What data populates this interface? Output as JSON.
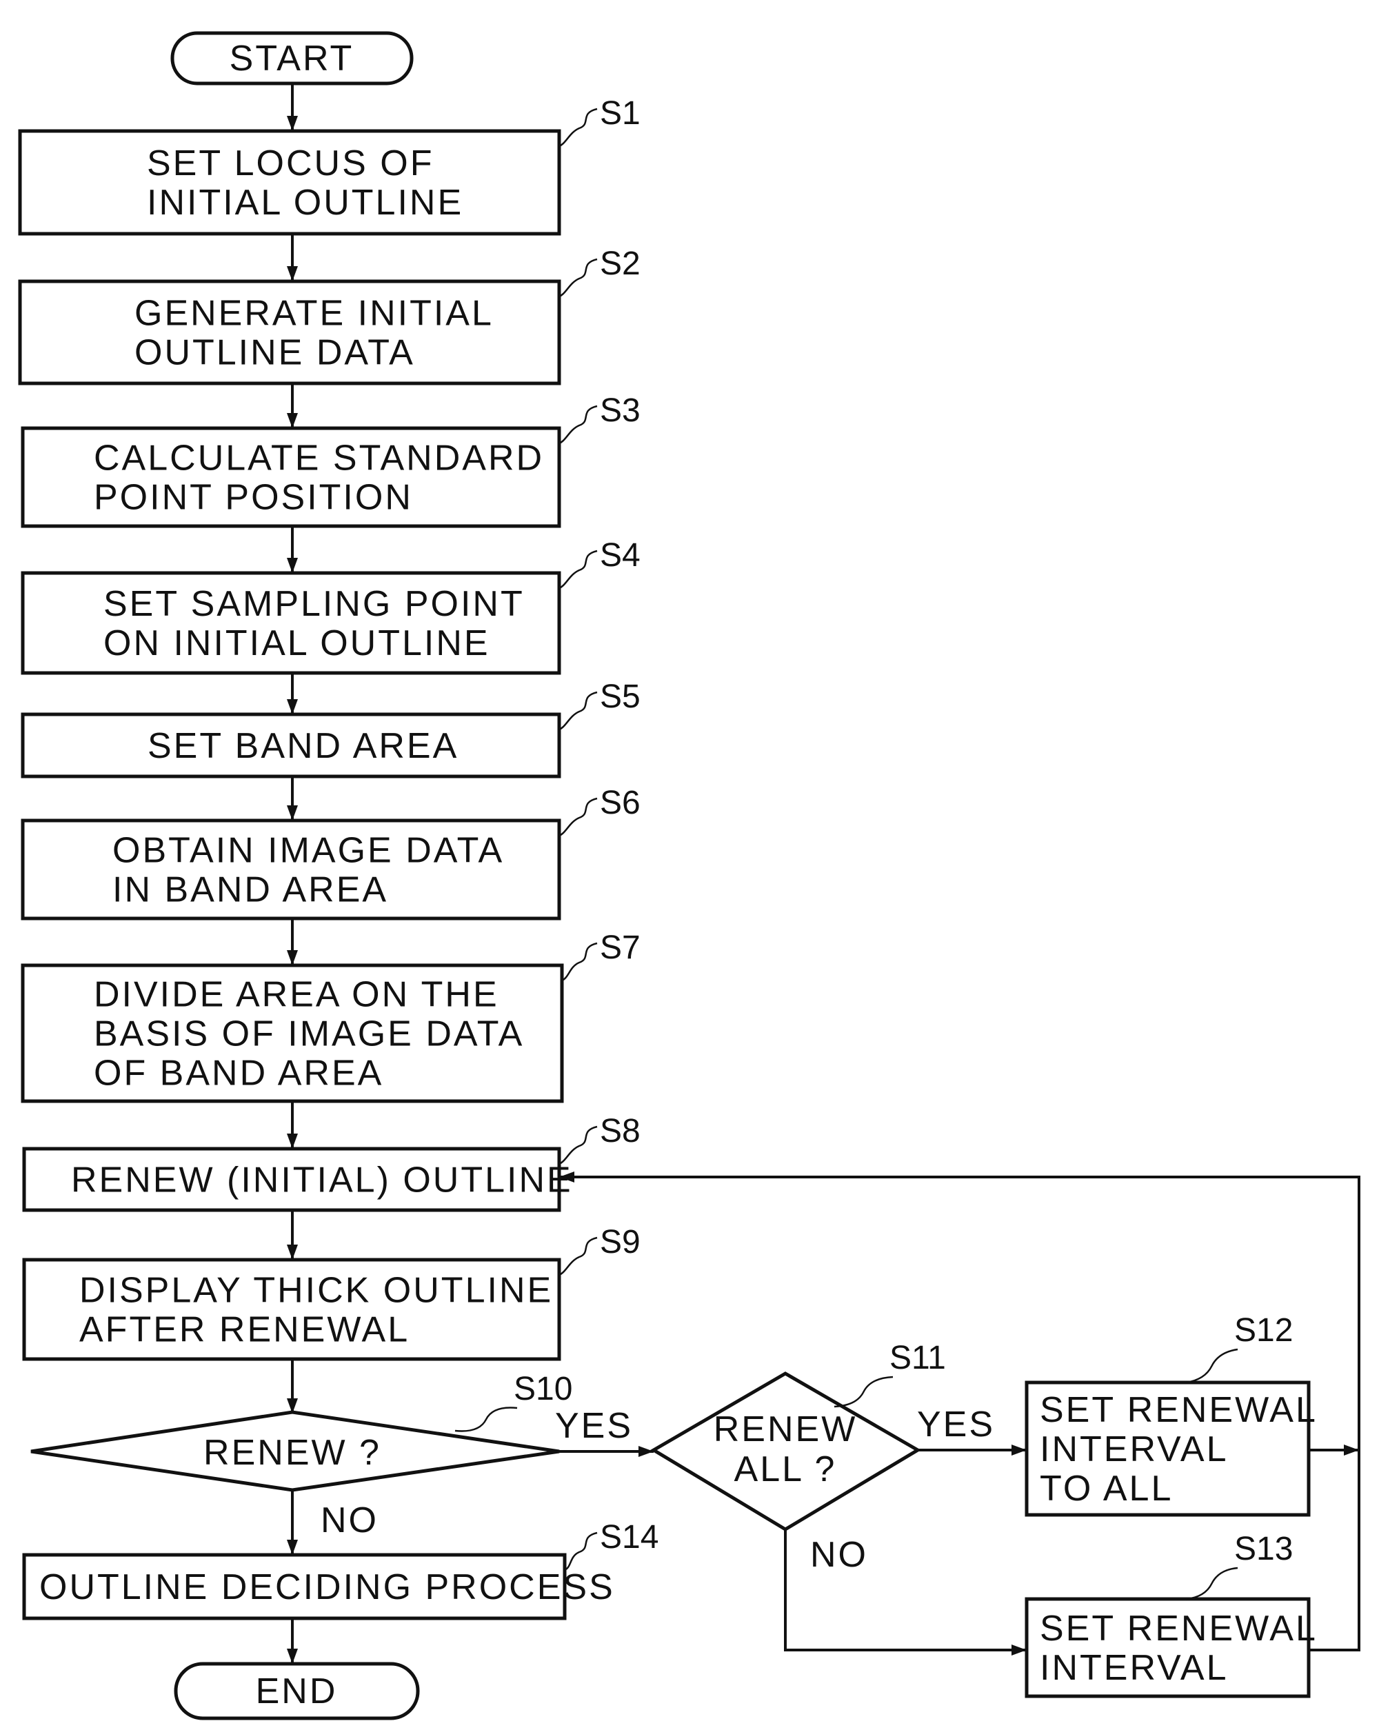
{
  "diagram": {
    "type": "flowchart",
    "terminals": {
      "start": "START",
      "end": "END"
    },
    "steps": [
      {
        "id": "S1",
        "lines": [
          "SET LOCUS OF",
          "INITIAL OUTLINE"
        ]
      },
      {
        "id": "S2",
        "lines": [
          "GENERATE INITIAL",
          "OUTLINE DATA"
        ]
      },
      {
        "id": "S3",
        "lines": [
          "CALCULATE STANDARD",
          "POINT POSITION"
        ]
      },
      {
        "id": "S4",
        "lines": [
          "SET SAMPLING POINT",
          "ON INITIAL OUTLINE"
        ]
      },
      {
        "id": "S5",
        "lines": [
          "SET BAND AREA"
        ]
      },
      {
        "id": "S6",
        "lines": [
          "OBTAIN IMAGE DATA",
          "IN BAND AREA"
        ]
      },
      {
        "id": "S7",
        "lines": [
          "DIVIDE AREA ON THE",
          "BASIS OF IMAGE DATA",
          "OF BAND AREA"
        ]
      },
      {
        "id": "S8",
        "lines": [
          "RENEW (INITIAL) OUTLINE"
        ]
      },
      {
        "id": "S9",
        "lines": [
          "DISPLAY THICK OUTLINE",
          "AFTER RENEWAL"
        ]
      },
      {
        "id": "S10",
        "lines": [
          "RENEW ?"
        ]
      },
      {
        "id": "S11",
        "lines": [
          "RENEW",
          "ALL ?"
        ]
      },
      {
        "id": "S12",
        "lines": [
          "SET RENEWAL",
          "INTERVAL",
          "TO ALL"
        ]
      },
      {
        "id": "S13",
        "lines": [
          "SET RENEWAL",
          "INTERVAL"
        ]
      },
      {
        "id": "S14",
        "lines": [
          "OUTLINE DECIDING PROCESS"
        ]
      }
    ],
    "branch_labels": {
      "s10_yes": "YES",
      "s10_no": "NO",
      "s11_yes": "YES",
      "s11_no": "NO"
    },
    "edges": [
      [
        "START",
        "S1"
      ],
      [
        "S1",
        "S2"
      ],
      [
        "S2",
        "S3"
      ],
      [
        "S3",
        "S4"
      ],
      [
        "S4",
        "S5"
      ],
      [
        "S5",
        "S6"
      ],
      [
        "S6",
        "S7"
      ],
      [
        "S7",
        "S8"
      ],
      [
        "S8",
        "S9"
      ],
      [
        "S9",
        "S10"
      ],
      [
        "S10",
        "S11",
        "YES"
      ],
      [
        "S10",
        "S14",
        "NO"
      ],
      [
        "S11",
        "S12",
        "YES"
      ],
      [
        "S11",
        "S13",
        "NO"
      ],
      [
        "S12",
        "S8"
      ],
      [
        "S13",
        "S8"
      ],
      [
        "S14",
        "END"
      ]
    ]
  }
}
